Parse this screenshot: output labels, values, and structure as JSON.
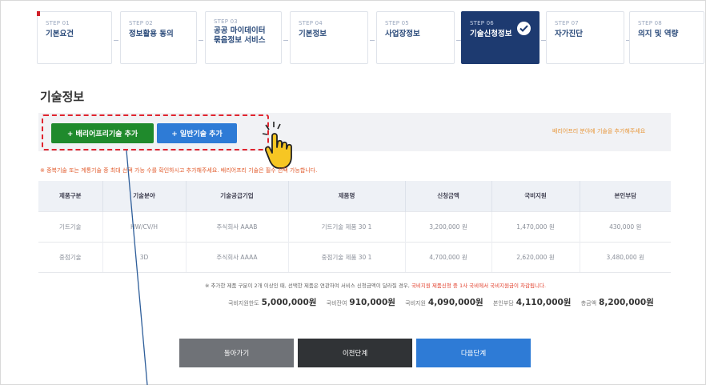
{
  "steps": [
    {
      "num": "STEP 01",
      "name": "기본요건"
    },
    {
      "num": "STEP 02",
      "name": "정보활용 동의"
    },
    {
      "num": "STEP 03",
      "name": "공공 마이데이터\n묶음정보 서비스"
    },
    {
      "num": "STEP 04",
      "name": "기본정보"
    },
    {
      "num": "STEP 05",
      "name": "사업장정보"
    },
    {
      "num": "STEP 06",
      "name": "기술신청정보"
    },
    {
      "num": "STEP 07",
      "name": "자가진단"
    },
    {
      "num": "STEP 08",
      "name": "의지 및 역량"
    }
  ],
  "active_step": 5,
  "section_title": "기술정보",
  "buttons": {
    "add_barrier_free": "+ 배리어프리기술 추가",
    "add_general": "+ 일반기술 추가"
  },
  "bar_note": "배리어프리 분야에 기술을 추가해주세요",
  "red_note": "※ 중복기술 또는 계통기술 중 최대 선택 가능 수를 확인하시고 추가해주세요. 배리어프리 기술은 필수 선택 가능합니다.",
  "table": {
    "headers": [
      "제품구분",
      "기술분야",
      "기술공급기업",
      "제품명",
      "신청금액",
      "국비지원",
      "본인부담"
    ],
    "rows": [
      [
        "기트기술",
        "HW/CV/H",
        "주식회사 AAAB",
        "기트기술 제품 30 1",
        "3,200,000 원",
        "1,470,000 원",
        "430,000 원"
      ],
      [
        "중점기술",
        "3D",
        "주식회사 AAAA",
        "중점기술 제품 30 1",
        "4,700,000 원",
        "2,620,000 원",
        "3,480,000 원"
      ]
    ]
  },
  "footnote": {
    "text": "※ 추가한 제품 구분이 2개 이상인 때, 선택한 제품은 연관하여 서비스 신청금액이 달라질 경우,",
    "highlight": "국비지원 제품신청 중 1사 국비에서 국비지원금이 차감됩니다."
  },
  "totals": [
    {
      "label": "국비지원한도",
      "value": "5,000,000원"
    },
    {
      "label": "국비잔여",
      "value": "910,000원"
    },
    {
      "label": "국비지원",
      "value": "4,090,000원"
    },
    {
      "label": "본인부담",
      "value": "4,110,000원"
    },
    {
      "label": "총금액",
      "value": "8,200,000원"
    }
  ],
  "nav": {
    "back": "돌아가기",
    "prev": "이전단계",
    "next": "다음단계"
  },
  "colors": {
    "active_step": "#1d3a70",
    "green_button": "#1f8a2c",
    "blue_button": "#2e7bd6",
    "highlight_border": "#e0242f"
  }
}
